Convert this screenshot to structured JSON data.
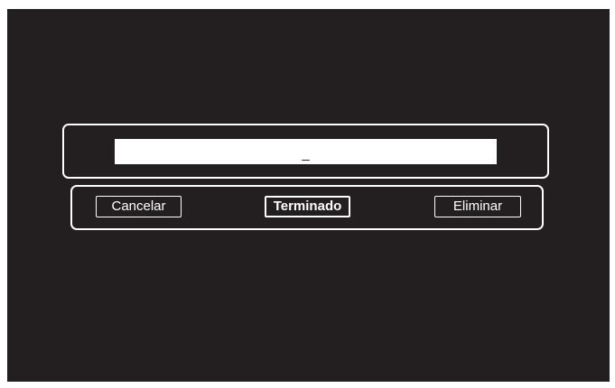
{
  "keyboard": {
    "input_value": "_",
    "buttons": {
      "cancel": "Cancelar",
      "done": "Terminado",
      "delete": "Eliminar"
    }
  },
  "colors": {
    "background": "#231f20",
    "foreground": "#ffffff"
  }
}
